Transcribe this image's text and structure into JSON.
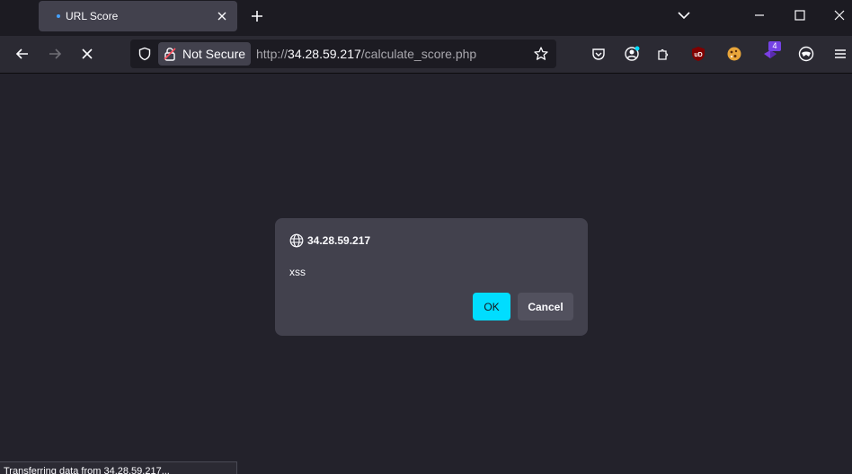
{
  "tab": {
    "title": "URL Score"
  },
  "urlbar": {
    "security_label": "Not Secure",
    "url_prefix": "http://",
    "url_host": "34.28.59.217",
    "url_path": "/calculate_score.php"
  },
  "extensions": {
    "badge_count": "4",
    "ublock_label": "uD"
  },
  "dialog": {
    "origin": "34.28.59.217",
    "message": "xss",
    "ok_label": "OK",
    "cancel_label": "Cancel"
  },
  "status_bar": {
    "text": "Transferring data from 34.28.59.217..."
  },
  "colors": {
    "accent": "#00ddff",
    "tab_bg": "#42414d",
    "page_bg": "#23222b"
  }
}
